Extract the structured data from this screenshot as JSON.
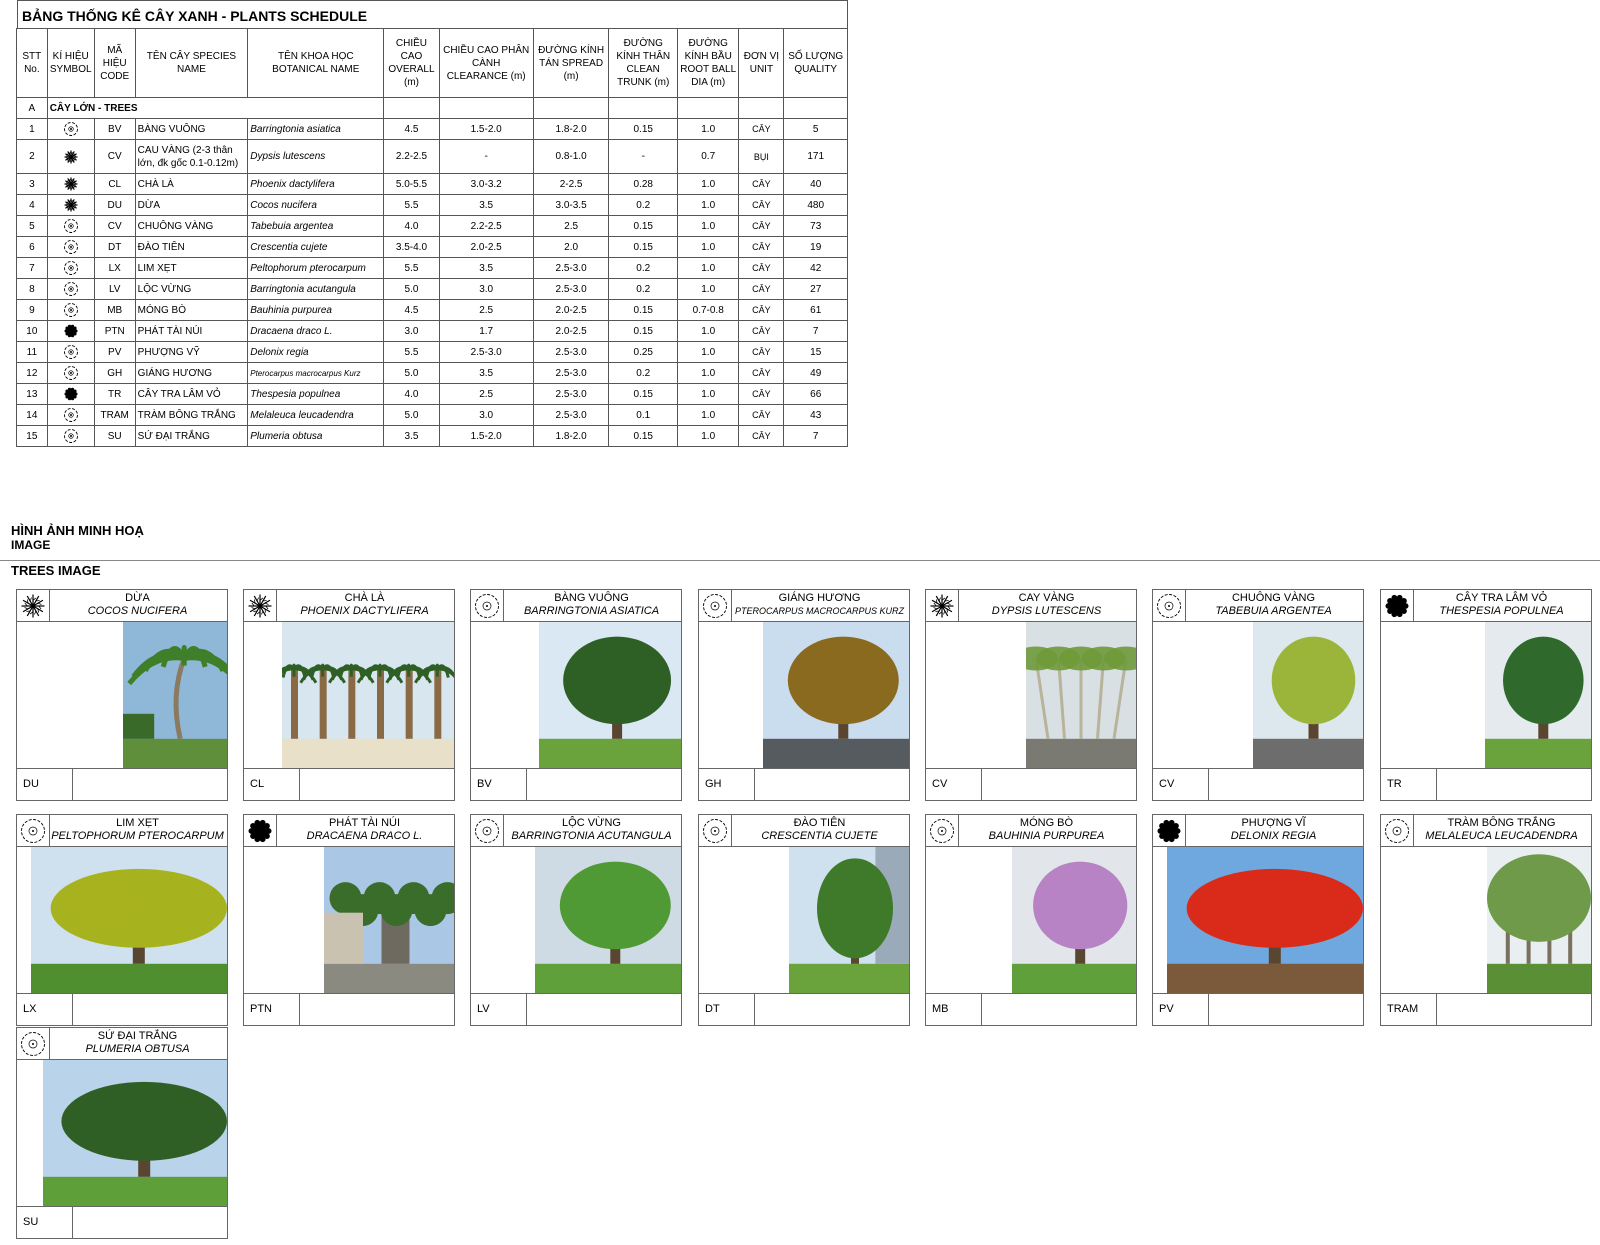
{
  "title": "BẢNG THỐNG KÊ CÂY XANH  - PLANTS SCHEDULE",
  "headers": {
    "stt": "STT No.",
    "symbol": "KÍ HIỆU SYMBOL",
    "code": "MÃ HIỆU CODE",
    "species": "TÊN CÂY SPECIES NAME",
    "botanical": "TÊN KHOA HỌC BOTANICAL NAME",
    "overall": "CHIỀU CAO OVERALL (m)",
    "clearance": "CHIỀU CAO PHÂN CÀNH CLEARANCE (m)",
    "spread": "ĐƯỜNG KÍNH TÁN SPREAD (m)",
    "trunk": "ĐƯỜNG KÍNH THÂN CLEAN TRUNK (m)",
    "rootball": "ĐƯỜNG KÍNH BẦU ROOT BALL DIA (m)",
    "unit": "ĐƠN VỊ UNIT",
    "quality": "SỐ LƯỢNG QUALITY"
  },
  "section": {
    "code": "A",
    "label": "CÂY LỚN - TREES"
  },
  "rows": [
    {
      "no": "1",
      "code": "BV",
      "name": "BÀNG VUÔNG",
      "sci": "Barringtonia asiatica",
      "overall": "4.5",
      "clearance": "1.5-2.0",
      "spread": "1.8-2.0",
      "trunk": "0.15",
      "rootball": "1.0",
      "unit": "CÂY",
      "qty": "5"
    },
    {
      "no": "2",
      "code": "CV",
      "name": "CAU VÀNG (2-3 thân lớn, đk gốc 0.1-0.12m)",
      "sci": "Dypsis lutescens",
      "overall": "2.2-2.5",
      "clearance": "-",
      "spread": "0.8-1.0",
      "trunk": "-",
      "rootball": "0.7",
      "unit": "BỤI",
      "qty": "171"
    },
    {
      "no": "3",
      "code": "CL",
      "name": "CHÀ LÀ",
      "sci": "Phoenix dactylifera",
      "overall": "5.0-5.5",
      "clearance": "3.0-3.2",
      "spread": "2-2.5",
      "trunk": "0.28",
      "rootball": "1.0",
      "unit": "CÂY",
      "qty": "40"
    },
    {
      "no": "4",
      "code": "DU",
      "name": "DỪA",
      "sci": "Cocos nucifera",
      "overall": "5.5",
      "clearance": "3.5",
      "spread": "3.0-3.5",
      "trunk": "0.2",
      "rootball": "1.0",
      "unit": "CÂY",
      "qty": "480"
    },
    {
      "no": "5",
      "code": "CV",
      "name": "CHUÔNG VÀNG",
      "sci": "Tabebuia argentea",
      "overall": "4.0",
      "clearance": "2.2-2.5",
      "spread": "2.5",
      "trunk": "0.15",
      "rootball": "1.0",
      "unit": "CÂY",
      "qty": "73"
    },
    {
      "no": "6",
      "code": "DT",
      "name": "ĐÀO TIÊN",
      "sci": "Crescentia cujete",
      "overall": "3.5-4.0",
      "clearance": "2.0-2.5",
      "spread": "2.0",
      "trunk": "0.15",
      "rootball": "1.0",
      "unit": "CÂY",
      "qty": "19"
    },
    {
      "no": "7",
      "code": "LX",
      "name": "LIM XẸT",
      "sci": "Peltophorum pterocarpum",
      "overall": "5.5",
      "clearance": "3.5",
      "spread": "2.5-3.0",
      "trunk": "0.2",
      "rootball": "1.0",
      "unit": "CÂY",
      "qty": "42"
    },
    {
      "no": "8",
      "code": "LV",
      "name": "LỘC VỪNG",
      "sci": "Barringtonia acutangula",
      "overall": "5.0",
      "clearance": "3.0",
      "spread": "2.5-3.0",
      "trunk": "0.2",
      "rootball": "1.0",
      "unit": "CÂY",
      "qty": "27"
    },
    {
      "no": "9",
      "code": "MB",
      "name": "MÓNG BÒ",
      "sci": "Bauhinia purpurea",
      "overall": "4.5",
      "clearance": "2.5",
      "spread": "2.0-2.5",
      "trunk": "0.15",
      "rootball": "0.7-0.8",
      "unit": "CÂY",
      "qty": "61"
    },
    {
      "no": "10",
      "code": "PTN",
      "name": "PHÁT TÀI NÚI",
      "sci": "Dracaena draco L.",
      "overall": "3.0",
      "clearance": "1.7",
      "spread": "2.0-2.5",
      "trunk": "0.15",
      "rootball": "1.0",
      "unit": "CÂY",
      "qty": "7"
    },
    {
      "no": "11",
      "code": "PV",
      "name": "PHƯỢNG VỸ",
      "sci": "Delonix regia",
      "overall": "5.5",
      "clearance": "2.5-3.0",
      "spread": "2.5-3.0",
      "trunk": "0.25",
      "rootball": "1.0",
      "unit": "CÂY",
      "qty": "15"
    },
    {
      "no": "12",
      "code": "GH",
      "name": "GIÁNG HƯƠNG",
      "sci": "Pterocarpus macrocarpus Kurz",
      "overall": "5.0",
      "clearance": "3.5",
      "spread": "2.5-3.0",
      "trunk": "0.2",
      "rootball": "1.0",
      "unit": "CÂY",
      "qty": "49"
    },
    {
      "no": "13",
      "code": "TR",
      "name": "CÂY TRA LÂM VỎ",
      "sci": "Thespesia populnea",
      "overall": "4.0",
      "clearance": "2.5",
      "spread": "2.5-3.0",
      "trunk": "0.15",
      "rootball": "1.0",
      "unit": "CÂY",
      "qty": "66"
    },
    {
      "no": "14",
      "code": "TRAM",
      "name": "TRÀM BÔNG TRẮNG",
      "sci": "Melaleuca leucadendra",
      "overall": "5.0",
      "clearance": "3.0",
      "spread": "2.5-3.0",
      "trunk": "0.1",
      "rootball": "1.0",
      "unit": "CÂY",
      "qty": "43"
    },
    {
      "no": "15",
      "code": "SU",
      "name": "SỨ ĐẠI TRẮNG",
      "sci": "Plumeria obtusa",
      "overall": "3.5",
      "clearance": "1.5-2.0",
      "spread": "1.8-2.0",
      "trunk": "0.15",
      "rootball": "1.0",
      "unit": "CÂY",
      "qty": "7"
    }
  ],
  "image_section": {
    "title": "HÌNH ẢNH MINH HOẠ",
    "subtitle": "IMAGE",
    "trees_label": "TREES IMAGE"
  },
  "cards": [
    {
      "name": "DỪA",
      "sci": "COCOS NUCIFERA",
      "code": "DU",
      "icon": "palm-symbol-icon",
      "photo": "palm",
      "sky": "#8fb8d8",
      "foliage": "#3f7f2a",
      "ground": "#5f8f3a"
    },
    {
      "name": "CHÀ LÀ",
      "sci": "PHOENIX DACTYLIFERA",
      "code": "CL",
      "icon": "palm-symbol-icon",
      "photo": "date-palms",
      "sky": "#d8e6f0",
      "foliage": "#2f5f25",
      "ground": "#e8e0c8"
    },
    {
      "name": "BÀNG VUÔNG",
      "sci": "BARRINGTONIA ASIATICA",
      "code": "BV",
      "icon": "tree-symbol-icon",
      "photo": "round",
      "sky": "#d9e8f2",
      "foliage": "#2e5f25",
      "ground": "#6aa33c"
    },
    {
      "name": "GIÁNG HƯƠNG",
      "sci": "PTEROCARPUS MACROCARPUS KURZ",
      "code": "GH",
      "icon": "tree-symbol-icon",
      "photo": "round",
      "sky": "#c9ddef",
      "foliage": "#8a6a1f",
      "ground": "#555b5e"
    },
    {
      "name": "CAY VÀNG",
      "sci": "DYPSIS LUTESCENS",
      "code": "CV",
      "icon": "palm-symbol-icon",
      "photo": "clump",
      "sky": "#d8e0e4",
      "foliage": "#6f9a3a",
      "ground": "#7a7a72"
    },
    {
      "name": "CHUÔNG VÀNG",
      "sci": "TABEBUIA ARGENTEA",
      "code": "CV",
      "icon": "tree-symbol-icon",
      "photo": "round",
      "sky": "#dde7ee",
      "foliage": "#9bb53a",
      "ground": "#6d6d6d"
    },
    {
      "name": "CÂY TRA LÂM VỎ",
      "sci": "THESPESIA POPULNEA",
      "code": "TR",
      "icon": "shrub-symbol-icon",
      "photo": "round",
      "sky": "#e4eaee",
      "foliage": "#2f6a2c",
      "ground": "#6aa33c"
    },
    {
      "name": "LIM XẸT",
      "sci": "PELTOPHORUM PTEROCARPUM",
      "code": "LX",
      "icon": "tree-symbol-icon",
      "photo": "wide",
      "sky": "#cfe0ef",
      "foliage": "#a7b21f",
      "ground": "#4f8f2f"
    },
    {
      "name": "PHÁT TÀI NÚI",
      "sci": "DRACAENA DRACO L.",
      "code": "PTN",
      "icon": "shrub-symbol-icon",
      "photo": "dragon",
      "sky": "#aac8e6",
      "foliage": "#3b6d2a",
      "ground": "#8a8a80"
    },
    {
      "name": "LỘC VỪNG",
      "sci": "BARRINGTONIA ACUTANGULA",
      "code": "LV",
      "icon": "tree-symbol-icon",
      "photo": "round",
      "sky": "#cfdbe4",
      "foliage": "#4f9a35",
      "ground": "#5fa03a"
    },
    {
      "name": "ĐÀO TIÊN",
      "sci": "CRESCENTIA CUJETE",
      "code": "DT",
      "icon": "tree-symbol-icon",
      "photo": "narrow",
      "sky": "#cfe0ee",
      "foliage": "#3f7a2a",
      "ground": "#6aa33c"
    },
    {
      "name": "MÓNG BÒ",
      "sci": "BAUHINIA PURPUREA",
      "code": "MB",
      "icon": "tree-symbol-icon",
      "photo": "round",
      "sky": "#e2e6ea",
      "foliage": "#b783c4",
      "ground": "#5fa03a"
    },
    {
      "name": "PHƯỢNG VĨ",
      "sci": "DELONIX REGIA",
      "code": "PV",
      "icon": "shrub-symbol-icon",
      "photo": "wide",
      "sky": "#6fa7df",
      "foliage": "#d92a1a",
      "ground": "#7a5a3a"
    },
    {
      "name": "TRÀM BÔNG TRẮNG",
      "sci": "MELALEUCA LEUCADENDRA",
      "code": "TRAM",
      "icon": "tree-symbol-icon",
      "photo": "tall",
      "sky": "#e9eef0",
      "foliage": "#6f9a4a",
      "ground": "#5a8f35"
    },
    {
      "name": "SỨ ĐẠI TRẮNG",
      "sci": "PLUMERIA OBTUSA",
      "code": "SU",
      "icon": "tree-symbol-icon",
      "photo": "wide",
      "sky": "#b9d3ea",
      "foliage": "#2f5f25",
      "ground": "#5f9f3a"
    }
  ]
}
